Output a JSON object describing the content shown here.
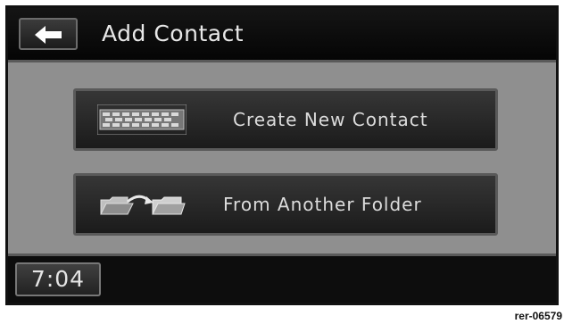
{
  "header": {
    "back_icon": "left-arrow-icon",
    "title": "Add Contact"
  },
  "options": [
    {
      "label": "Create New Contact",
      "icon": "keyboard-icon"
    },
    {
      "label": "From Another Folder",
      "icon": "folder-transfer-icon"
    }
  ],
  "footer": {
    "clock": "7:04"
  },
  "image_ref": "rer-06579"
}
